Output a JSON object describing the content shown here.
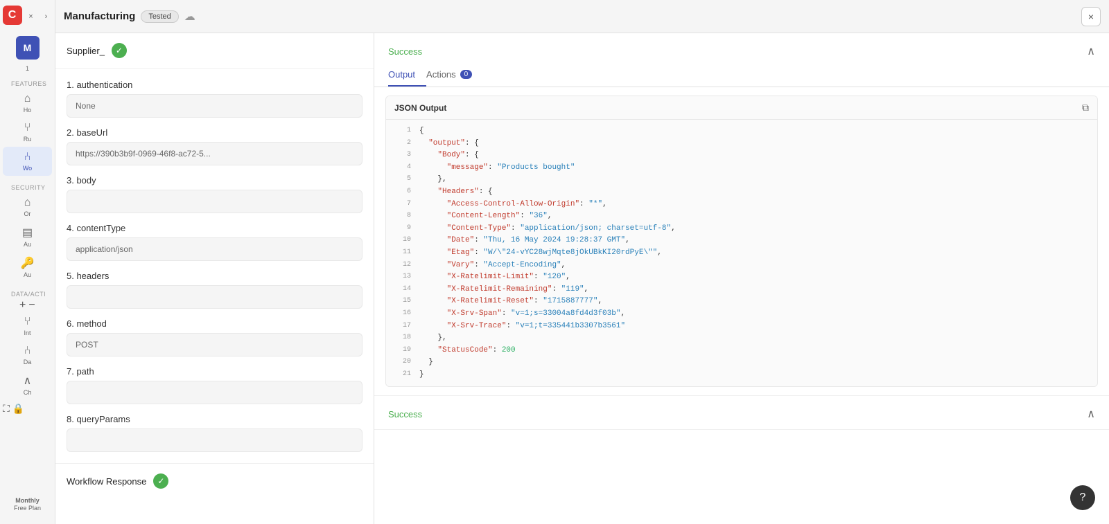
{
  "sidebar": {
    "logo": "C",
    "title": "Manufacturing",
    "badge": "Tested",
    "avatar": "M",
    "avatar_sub": "1",
    "sections": [
      {
        "label": "FEATURES",
        "items": [
          {
            "id": "home",
            "icon": "⌂",
            "label": "Ho"
          },
          {
            "id": "run",
            "icon": "⑂",
            "label": "Ru"
          },
          {
            "id": "workflow",
            "icon": "⑃",
            "label": "Wo",
            "active": true
          }
        ]
      },
      {
        "label": "SECURITY",
        "items": [
          {
            "id": "org",
            "icon": "⌂",
            "label": "Or"
          },
          {
            "id": "auth",
            "icon": "▤",
            "label": "Au"
          },
          {
            "id": "api",
            "icon": "⚷",
            "label": "Au"
          }
        ]
      },
      {
        "label": "DATA/ACTI",
        "items": [
          {
            "id": "int",
            "icon": "⑂",
            "label": "Int"
          },
          {
            "id": "data",
            "icon": "⑃",
            "label": "Da"
          },
          {
            "id": "ch",
            "icon": "∧",
            "label": "Ch"
          }
        ]
      }
    ],
    "plan": "Monthly",
    "plan_sub": "Free Plan"
  },
  "topbar": {
    "title": "Manufacturing",
    "badge": "Tested",
    "close_label": "×"
  },
  "params": {
    "node_label": "Supplier_",
    "fields": [
      {
        "id": "authentication",
        "label": "1. authentication",
        "value": "None"
      },
      {
        "id": "baseUrl",
        "label": "2. baseUrl",
        "value": "https://390b3b9f-0969-46f8-ac72-5..."
      },
      {
        "id": "body",
        "label": "3. body",
        "value": ""
      },
      {
        "id": "contentType",
        "label": "4. contentType",
        "value": "application/json"
      },
      {
        "id": "headers",
        "label": "5. headers",
        "value": ""
      },
      {
        "id": "method",
        "label": "6. method",
        "value": "POST"
      },
      {
        "id": "path",
        "label": "7. path",
        "value": ""
      },
      {
        "id": "queryParams",
        "label": "8. queryParams",
        "value": ""
      }
    ],
    "workflow_response_label": "Workflow Response"
  },
  "output": {
    "success_label": "Success",
    "tabs": [
      {
        "id": "output",
        "label": "Output",
        "active": true,
        "badge": null
      },
      {
        "id": "actions",
        "label": "Actions",
        "active": false,
        "badge": "0"
      }
    ],
    "json_title": "JSON Output",
    "lines": [
      {
        "num": 1,
        "content": "{"
      },
      {
        "num": 2,
        "content": "  \"output\": {"
      },
      {
        "num": 3,
        "content": "    \"Body\": {"
      },
      {
        "num": 4,
        "content": "      \"message\": \"Products bought\""
      },
      {
        "num": 5,
        "content": "    },"
      },
      {
        "num": 6,
        "content": "    \"Headers\": {"
      },
      {
        "num": 7,
        "content": "      \"Access-Control-Allow-Origin\": \"*\","
      },
      {
        "num": 8,
        "content": "      \"Content-Length\": \"36\","
      },
      {
        "num": 9,
        "content": "      \"Content-Type\": \"application/json; charset=utf-8\","
      },
      {
        "num": 10,
        "content": "      \"Date\": \"Thu, 16 May 2024 19:28:37 GMT\","
      },
      {
        "num": 11,
        "content": "      \"Etag\": \"W/\\\"24-vYC28wjMqte8jOkUBkKI20rdPyE\\\"\","
      },
      {
        "num": 12,
        "content": "      \"Vary\": \"Accept-Encoding\","
      },
      {
        "num": 13,
        "content": "      \"X-Ratelimit-Limit\": \"120\","
      },
      {
        "num": 14,
        "content": "      \"X-Ratelimit-Remaining\": \"119\","
      },
      {
        "num": 15,
        "content": "      \"X-Ratelimit-Reset\": \"1715887777\","
      },
      {
        "num": 16,
        "content": "      \"X-Srv-Span\": \"v=1;s=33004a8fd4d3f03b\","
      },
      {
        "num": 17,
        "content": "      \"X-Srv-Trace\": \"v=1;t=335441b3307b3561\""
      },
      {
        "num": 18,
        "content": "    },"
      },
      {
        "num": 19,
        "content": "    \"StatusCode\": 200"
      },
      {
        "num": 20,
        "content": "  }"
      },
      {
        "num": 21,
        "content": "}"
      }
    ],
    "success2_label": "Success"
  },
  "help_label": "?"
}
